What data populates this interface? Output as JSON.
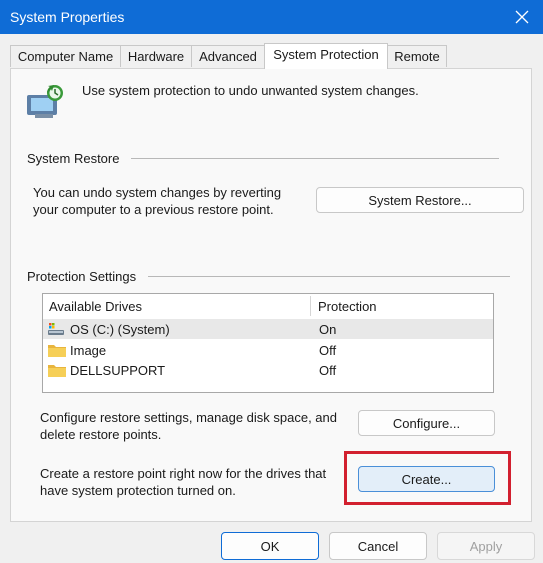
{
  "window": {
    "title": "System Properties",
    "accent_color": "#0f6cd6",
    "close_icon": "close-icon"
  },
  "tabs": [
    {
      "label": "Computer Name",
      "active": false
    },
    {
      "label": "Hardware",
      "active": false
    },
    {
      "label": "Advanced",
      "active": false
    },
    {
      "label": "System Protection",
      "active": true
    },
    {
      "label": "Remote",
      "active": false
    }
  ],
  "intro": {
    "icon": "system-protection-icon",
    "text": "Use system protection to undo unwanted system changes."
  },
  "system_restore": {
    "heading": "System Restore",
    "description_line1": "You can undo system changes by reverting",
    "description_line2": "your computer to a previous restore point.",
    "button_label": "System Restore..."
  },
  "protection_settings": {
    "heading": "Protection Settings",
    "columns": {
      "drive": "Available Drives",
      "protection": "Protection"
    },
    "drives": [
      {
        "name": "OS (C:) (System)",
        "protection": "On",
        "icon": "system-drive-icon",
        "selected": true
      },
      {
        "name": "Image",
        "protection": "Off",
        "icon": "folder-drive-icon",
        "selected": false
      },
      {
        "name": "DELLSUPPORT",
        "protection": "Off",
        "icon": "folder-drive-icon",
        "selected": false
      }
    ],
    "configure_line1": "Configure restore settings, manage disk space, and",
    "configure_line2": "delete restore points.",
    "configure_button": "Configure...",
    "create_line1": "Create a restore point right now for the drives that",
    "create_line2": "have system protection turned on.",
    "create_button": "Create...",
    "highlight_color": "#d2202f"
  },
  "footer": {
    "ok": "OK",
    "cancel": "Cancel",
    "apply": "Apply"
  }
}
